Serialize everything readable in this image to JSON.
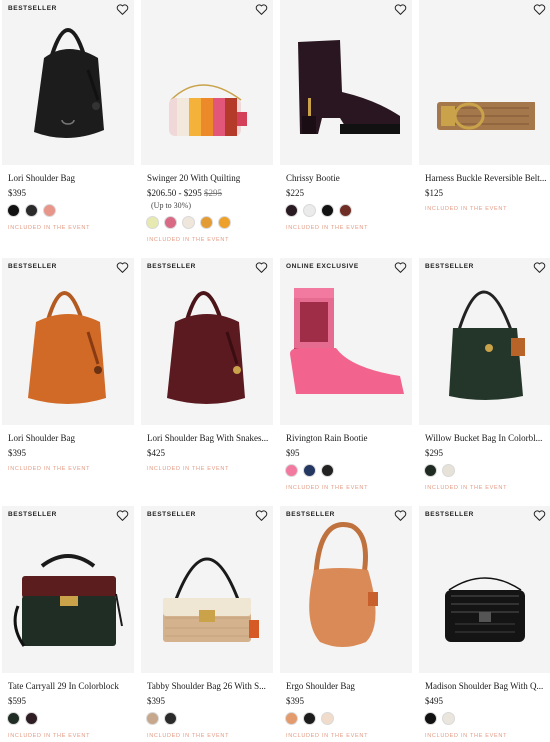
{
  "products": [
    {
      "badge": "BESTSELLER",
      "name": "Lori Shoulder Bag",
      "price": "$395",
      "swatches": [
        "#111111",
        "#2a2a2a",
        "#e8958a"
      ],
      "event": "INCLUDED IN THE EVENT",
      "art": "lori-black"
    },
    {
      "badge": "",
      "name": "Swinger 20 With Quilting",
      "price": "$206.50 - $295",
      "orig": "$295",
      "discount": "(Up to 30%)",
      "swatches": [
        "#e6eab0",
        "#d86a85",
        "#efe6dc",
        "#e39b35",
        "#eea12a"
      ],
      "event": "INCLUDED IN THE EVENT",
      "art": "swinger"
    },
    {
      "badge": "",
      "name": "Chrissy Bootie",
      "price": "$225",
      "swatches": [
        "#2a1a22",
        "#ebebeb",
        "#111111",
        "#6e2d25"
      ],
      "event": "INCLUDED IN THE EVENT",
      "art": "bootie"
    },
    {
      "badge": "",
      "name": "Harness Buckle Reversible Belt...",
      "price": "$125",
      "swatches": [],
      "event": "INCLUDED IN THE EVENT",
      "art": "belt"
    },
    {
      "badge": "BESTSELLER",
      "name": "Lori Shoulder Bag",
      "price": "$395",
      "swatches": [],
      "event": "INCLUDED IN THE EVENT",
      "art": "lori-orange"
    },
    {
      "badge": "BESTSELLER",
      "name": "Lori Shoulder Bag With Snakes...",
      "price": "$425",
      "swatches": [],
      "event": "INCLUDED IN THE EVENT",
      "art": "lori-wine"
    },
    {
      "badge": "ONLINE EXCLUSIVE",
      "name": "Rivington Rain Bootie",
      "price": "$95",
      "swatches": [
        "#f27aa0",
        "#243760",
        "#222222"
      ],
      "event": "INCLUDED IN THE EVENT",
      "art": "rainboot"
    },
    {
      "badge": "BESTSELLER",
      "name": "Willow Bucket Bag In Colorbl...",
      "price": "$295",
      "swatches": [
        "#1f2a22",
        "#e7e2d8"
      ],
      "event": "INCLUDED IN THE EVENT",
      "art": "willow"
    },
    {
      "badge": "BESTSELLER",
      "name": "Tate Carryall 29 In Colorblock",
      "price": "$595",
      "swatches": [
        "#1f2d25",
        "#2f1d24"
      ],
      "event": "INCLUDED IN THE EVENT",
      "art": "tate"
    },
    {
      "badge": "BESTSELLER",
      "name": "Tabby Shoulder Bag 26 With S...",
      "price": "$395",
      "swatches": [
        "#c7a88c",
        "#2b2b2b"
      ],
      "event": "INCLUDED IN THE EVENT",
      "art": "tabby"
    },
    {
      "badge": "BESTSELLER",
      "name": "Ergo Shoulder Bag",
      "price": "$395",
      "swatches": [
        "#e39a6c",
        "#1c1c1c",
        "#f1dccb"
      ],
      "event": "INCLUDED IN THE EVENT",
      "art": "ergo"
    },
    {
      "badge": "BESTSELLER",
      "name": "Madison Shoulder Bag With Q...",
      "price": "$495",
      "swatches": [
        "#111111",
        "#ebe6dd"
      ],
      "event": "INCLUDED IN THE EVENT",
      "art": "madison"
    }
  ],
  "icons": {
    "wishlist": "heart-outline-icon"
  }
}
